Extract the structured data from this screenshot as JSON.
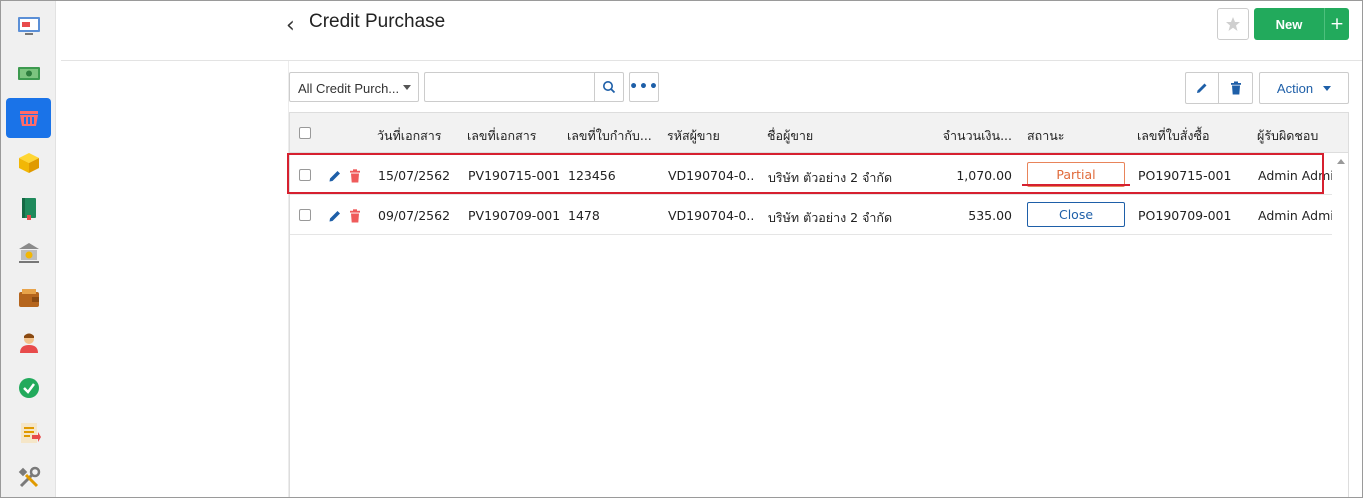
{
  "app": {
    "title": "Credit Purchase",
    "new_label": "New",
    "plus_label": "+",
    "back_label": "‹"
  },
  "sidebar": {
    "items": [
      {
        "name": "dashboard-icon"
      },
      {
        "name": "sales-money-icon"
      },
      {
        "name": "purchase-basket-icon",
        "active": true
      },
      {
        "name": "inventory-box-icon"
      },
      {
        "name": "ledger-book-icon"
      },
      {
        "name": "bank-icon"
      },
      {
        "name": "wallet-icon"
      },
      {
        "name": "contacts-person-icon"
      },
      {
        "name": "approve-check-icon"
      },
      {
        "name": "report-icon"
      },
      {
        "name": "settings-tools-icon"
      }
    ]
  },
  "filter": {
    "select_value": "All Credit Purch...",
    "search_placeholder": "",
    "more_label": "•••",
    "action_label": "Action"
  },
  "table": {
    "headers": [
      "วันที่เอกสาร",
      "เลขที่เอกสาร",
      "เลขที่ใบกำกับ...",
      "รหัสผู้ขาย",
      "ชื่อผู้ขาย",
      "จำนวนเงิน...",
      "สถานะ",
      "เลขที่ใบสั่งซื้อ",
      "ผู้รับผิดชอบ"
    ],
    "rows": [
      {
        "date": "15/07/2562",
        "doc_no": "PV190715-001",
        "tax_inv": "123456",
        "vendor_code": "VD190704-0...",
        "vendor_name": "บริษัท ตัวอย่าง 2 จำกัด",
        "amount": "1,070.00",
        "status": "Partial",
        "po_no": "PO190715-001",
        "owner": "Admin Admin"
      },
      {
        "date": "09/07/2562",
        "doc_no": "PV190709-001",
        "tax_inv": "1478",
        "vendor_code": "VD190704-0...",
        "vendor_name": "บริษัท ตัวอย่าง 2 จำกัด",
        "amount": "535.00",
        "status": "Close",
        "po_no": "PO190709-001",
        "owner": "Admin Admin"
      }
    ]
  },
  "colors": {
    "accent_blue": "#1a73e8",
    "new_green": "#22aa5c",
    "partial_orange": "#e06a3a",
    "close_blue": "#1e5fa8",
    "highlight_red": "#d6202f"
  }
}
